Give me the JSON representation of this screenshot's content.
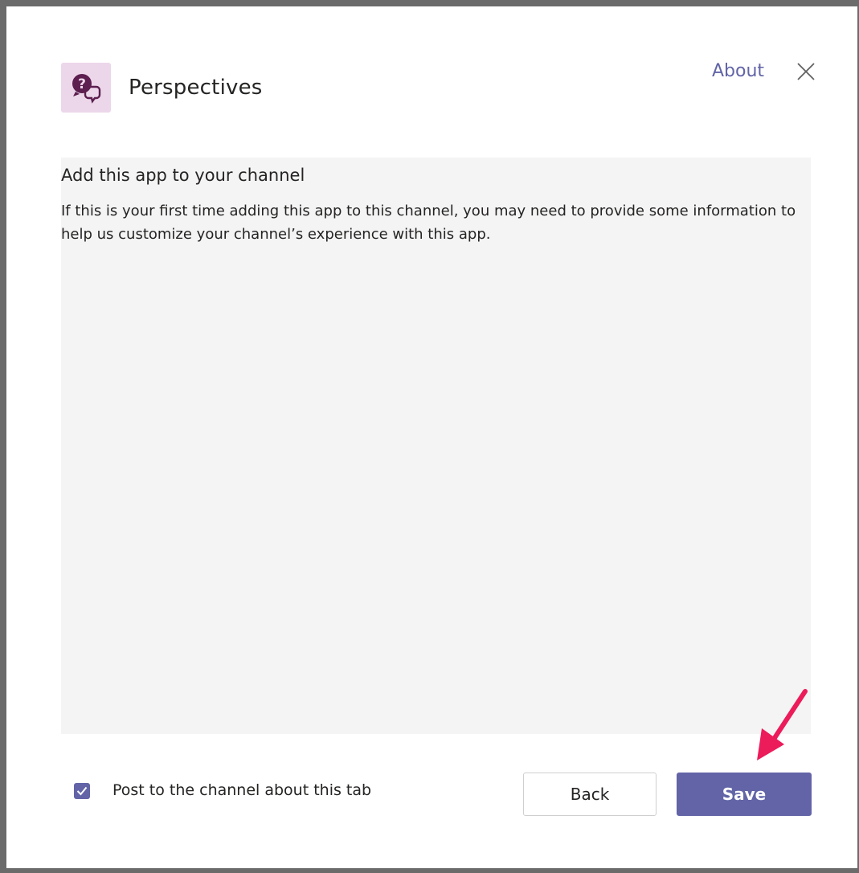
{
  "header": {
    "app_name": "Perspectives",
    "about_label": "About",
    "app_icon": "chat-question-icon",
    "close_icon": "close-icon"
  },
  "content": {
    "heading": "Add this app to your channel",
    "description": "If this is your first time adding this app to this channel, you may need to provide some information to help us customize your channel’s experience with this app."
  },
  "footer": {
    "checkbox_checked": true,
    "checkbox_label": "Post to the channel about this tab",
    "back_label": "Back",
    "save_label": "Save"
  },
  "colors": {
    "accent": "#6264a7",
    "icon_tile": "#ecd7ea",
    "icon_glyph": "#5c1f4f",
    "panel_bg": "#f4f4f4",
    "annotation_arrow": "#ec1b5a"
  }
}
